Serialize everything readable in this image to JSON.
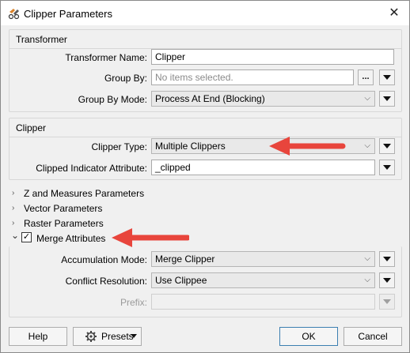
{
  "window": {
    "title": "Clipper Parameters",
    "close_glyph": "✕",
    "icon": "clipper-transformer-icon"
  },
  "transformer_section": {
    "title": "Transformer",
    "name_label": "Transformer Name:",
    "name_value": "Clipper",
    "group_by_label": "Group By:",
    "group_by_placeholder": "No items selected.",
    "ellipsis_glyph": "...",
    "group_by_mode_label": "Group By Mode:",
    "group_by_mode_value": "Process At End (Blocking)"
  },
  "clipper_section": {
    "title": "Clipper",
    "clipper_type_label": "Clipper Type:",
    "clipper_type_value": "Multiple Clippers",
    "indicator_label": "Clipped Indicator Attribute:",
    "indicator_value": "_clipped"
  },
  "collapsed_sections": [
    {
      "label": "Z and Measures Parameters"
    },
    {
      "label": "Vector Parameters"
    },
    {
      "label": "Raster Parameters"
    }
  ],
  "merge_section": {
    "title": "Merge Attributes",
    "checked": true,
    "check_glyph": "✓",
    "accumulation_label": "Accumulation Mode:",
    "accumulation_value": "Merge Clipper",
    "conflict_label": "Conflict Resolution:",
    "conflict_value": "Use Clippee",
    "prefix_label": "Prefix:",
    "prefix_value": ""
  },
  "footer": {
    "help_label": "Help",
    "presets_label": "Presets",
    "ok_label": "OK",
    "cancel_label": "Cancel"
  },
  "glyphs": {
    "chevron_down": "⌵",
    "collapsed_arrow": "›",
    "expanded_arrow": "⌄"
  },
  "colors": {
    "annotation_arrow": "#e8453c",
    "ok_border": "#3c7fb1"
  }
}
